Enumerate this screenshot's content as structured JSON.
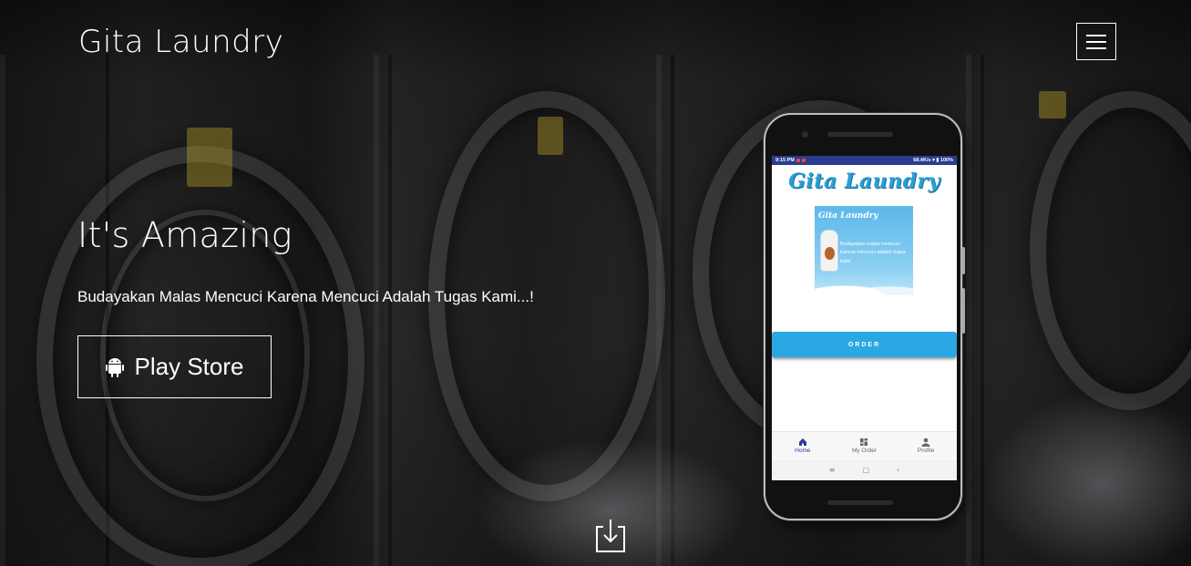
{
  "header": {
    "brand": "Gita Laundry",
    "menu_icon": "hamburger-icon"
  },
  "hero": {
    "title": "It's Amazing",
    "subtitle": "Budayakan Malas Mencuci Karena Mencuci Adalah Tugas Kami...!",
    "cta_label": "Play Store",
    "cta_icon": "android-icon",
    "scroll_icon": "download-arrow-icon"
  },
  "phone": {
    "statusbar": {
      "time": "9:15 PM",
      "network": "68.4K/s",
      "battery": "100%"
    },
    "app_title": "Gita Laundry",
    "banner": {
      "logo": "Gita Laundry",
      "text": "Budayakan malas mencuci karena mencuci adalah tugas kami"
    },
    "order_label": "ORDER",
    "bottom_nav": [
      {
        "label": "Home",
        "icon": "home-icon"
      },
      {
        "label": "My Order",
        "icon": "grid-icon"
      },
      {
        "label": "Profile",
        "icon": "person-icon"
      }
    ],
    "system_nav": [
      "≡",
      "▢",
      "‹"
    ]
  },
  "colors": {
    "accent": "#29a8e4",
    "statusbar": "#2b3b8f",
    "logo_blue": "#2a9fd6"
  }
}
